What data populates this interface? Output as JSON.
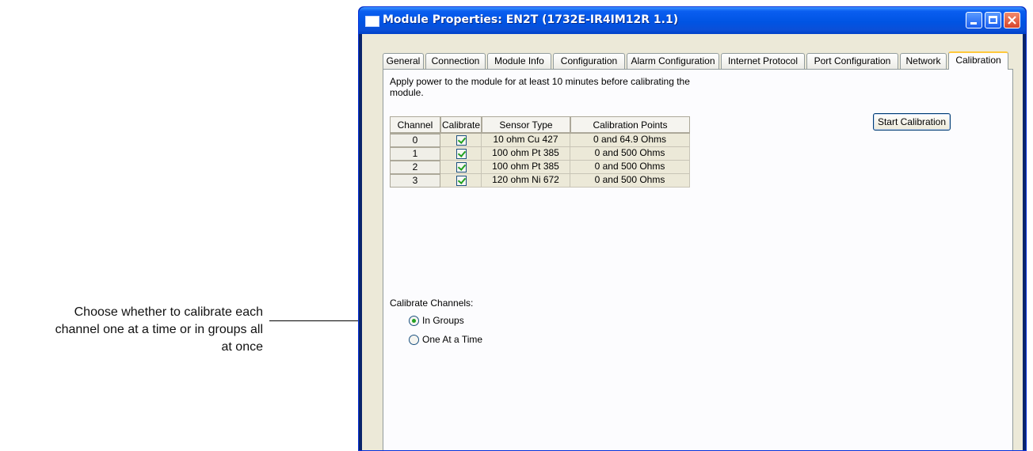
{
  "callout": {
    "lines": [
      "Choose whether to calibrate each",
      "channel one at a time or in groups all",
      "at once"
    ]
  },
  "window": {
    "title": "Module Properties: EN2T (1732E-IR4IM12R 1.1)"
  },
  "tabs": [
    {
      "label": "General",
      "active": false
    },
    {
      "label": "Connection",
      "active": false
    },
    {
      "label": "Module Info",
      "active": false
    },
    {
      "label": "Configuration",
      "active": false
    },
    {
      "label": "Alarm Configuration",
      "active": false
    },
    {
      "label": "Internet Protocol",
      "active": false
    },
    {
      "label": "Port Configuration",
      "active": false
    },
    {
      "label": "Network",
      "active": false
    },
    {
      "label": "Calibration",
      "active": true
    }
  ],
  "calibration": {
    "instructions": "Apply power to the module for at least 10 minutes before calibrating the module.",
    "start_button": "Start Calibration",
    "grid": {
      "headers": [
        "Channel",
        "Calibrate",
        "Sensor Type",
        "Calibration Points"
      ],
      "rows": [
        {
          "channel": "0",
          "calibrate": true,
          "sensor_type": "10 ohm Cu 427",
          "points": "0 and 64.9 Ohms"
        },
        {
          "channel": "1",
          "calibrate": true,
          "sensor_type": "100 ohm Pt 385",
          "points": "0 and 500 Ohms"
        },
        {
          "channel": "2",
          "calibrate": true,
          "sensor_type": "100 ohm Pt 385",
          "points": "0 and 500 Ohms"
        },
        {
          "channel": "3",
          "calibrate": true,
          "sensor_type": "120 ohm Ni 672",
          "points": "0 and 500 Ohms"
        }
      ]
    },
    "calibrate_channels": {
      "label": "Calibrate Channels:",
      "options": [
        {
          "label": "In Groups",
          "selected": true
        },
        {
          "label": "One At a Time",
          "selected": false
        }
      ]
    }
  },
  "colors": {
    "titlebar": "#0054e3",
    "client_bg": "#ece9d8",
    "check_green": "#21a121",
    "active_tab_accent": "#ffc83c"
  }
}
